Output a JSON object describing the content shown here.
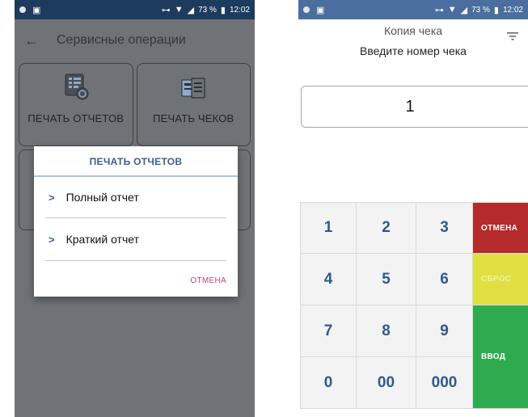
{
  "left": {
    "status": {
      "battery": "73 %",
      "time": "12:02"
    },
    "appbar": {
      "title": "Сервисные операции"
    },
    "tiles": [
      {
        "label": "ПЕЧАТЬ ОТЧЕТОВ"
      },
      {
        "label": "ПЕЧАТЬ ЧЕКОВ"
      }
    ],
    "dialog": {
      "title": "ПЕЧАТЬ ОТЧЕТОВ",
      "items": [
        {
          "label": "Полный отчет"
        },
        {
          "label": "Краткий отчет"
        }
      ],
      "cancel": "ОТМЕНА"
    }
  },
  "right": {
    "status": {
      "battery": "73 %",
      "time": "12:02"
    },
    "header": {
      "title": "Копия чека"
    },
    "prompt": "Введите номер чека",
    "field_value": "1",
    "keypad": {
      "digits": [
        "1",
        "2",
        "3",
        "4",
        "5",
        "6",
        "7",
        "8",
        "9",
        "0",
        "00",
        "000"
      ],
      "cancel": "ОТМЕНА",
      "reset": "СБРОС",
      "enter": "ВВОД"
    }
  },
  "colors": {
    "overlay": "#6f7276",
    "accent": "#3b5f8e",
    "cancel_pink": "#c0457a",
    "key_cancel": "#b52a2a",
    "key_reset": "#e0e043",
    "key_enter": "#2faa4e"
  }
}
